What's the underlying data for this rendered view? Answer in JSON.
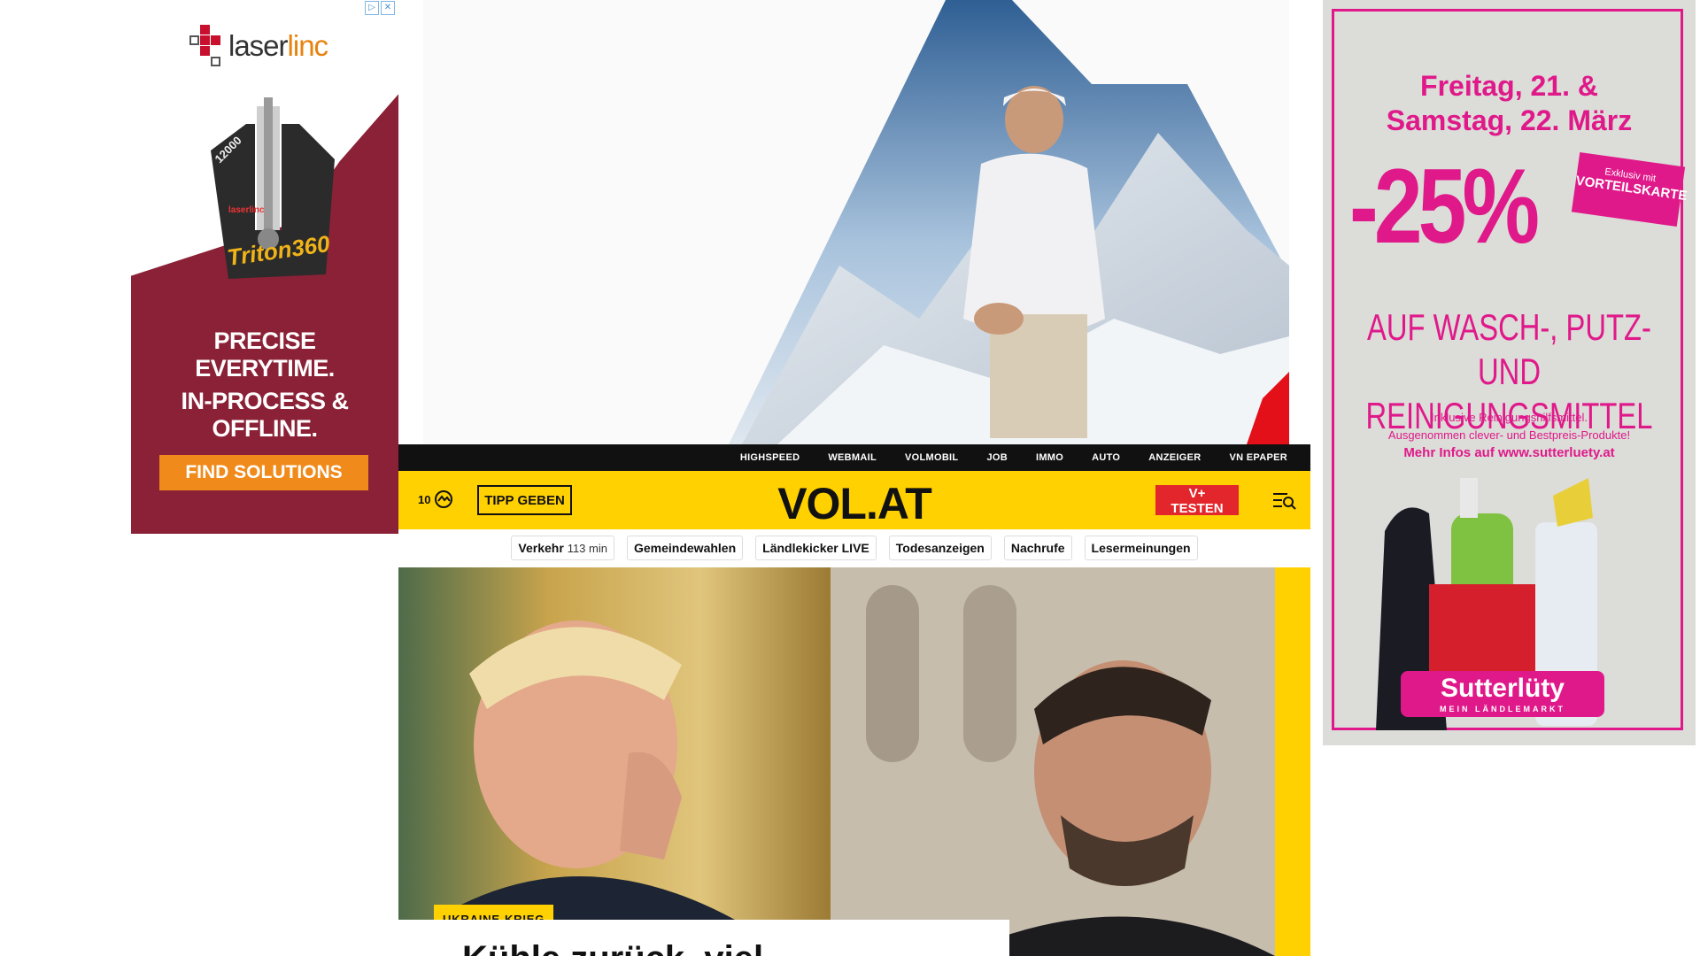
{
  "ad_left": {
    "brand_prefix": "laser",
    "brand_suffix": "linc",
    "product_small": "laserlinc",
    "product_name": "Triton360",
    "device_label": "12000",
    "headline_line1": "PRECISE",
    "headline_line2": "EVERYTIME.",
    "headline_line3": "IN-PROCESS &",
    "headline_line4": "OFFLINE.",
    "cta": "FIND SOLUTIONS",
    "adchoices_icon": "adchoices-icon",
    "close_icon": "close-icon"
  },
  "ad_right": {
    "date_line1": "Freitag, 21. &",
    "date_line2": "Samstag, 22. März",
    "discount": "-25%",
    "badge_line1": "Exklusiv mit",
    "badge_line2": "VORTEILSKARTE",
    "offer_line1": "AUF WASCH-, PUTZ-",
    "offer_line2": "UND REINIGUNGSMITTEL",
    "note_line1": "Inklusive Reinigungshilfsmittel.",
    "note_line2": "Ausgenommen clever- und Bestpreis-Produkte!",
    "note_line3": "Mehr Infos auf www.sutterluety.at",
    "brand": "Sutterlüty",
    "brand_tagline": "MEIN LÄNDLEMARKT",
    "accent_color": "#e0198a"
  },
  "topnav": {
    "items": [
      "HIGHSPEED",
      "WEBMAIL",
      "VOLMOBIL",
      "JOB",
      "IMMO",
      "AUTO",
      "ANZEIGER",
      "VN EPAPER"
    ]
  },
  "header": {
    "temperature": "10",
    "weather_icon": "cloud-sun-icon",
    "tipp_button": "TIPP GEBEN",
    "logo": "VOL.AT",
    "vplus_button": "V+ TESTEN",
    "menu_icon": "menu-search-icon",
    "accent_color": "#ffd100"
  },
  "quicklinks": [
    {
      "label": "Verkehr",
      "extra": "113 min"
    },
    {
      "label": "Gemeindewahlen",
      "extra": ""
    },
    {
      "label": "Ländlekicker LIVE",
      "extra": ""
    },
    {
      "label": "Todesanzeigen",
      "extra": ""
    },
    {
      "label": "Nachrufe",
      "extra": ""
    },
    {
      "label": "Lesermeinungen",
      "extra": ""
    }
  ],
  "teaser": {
    "tag": "UKRAINE-KRIEG",
    "headline": "Kühle zurück, viel"
  }
}
